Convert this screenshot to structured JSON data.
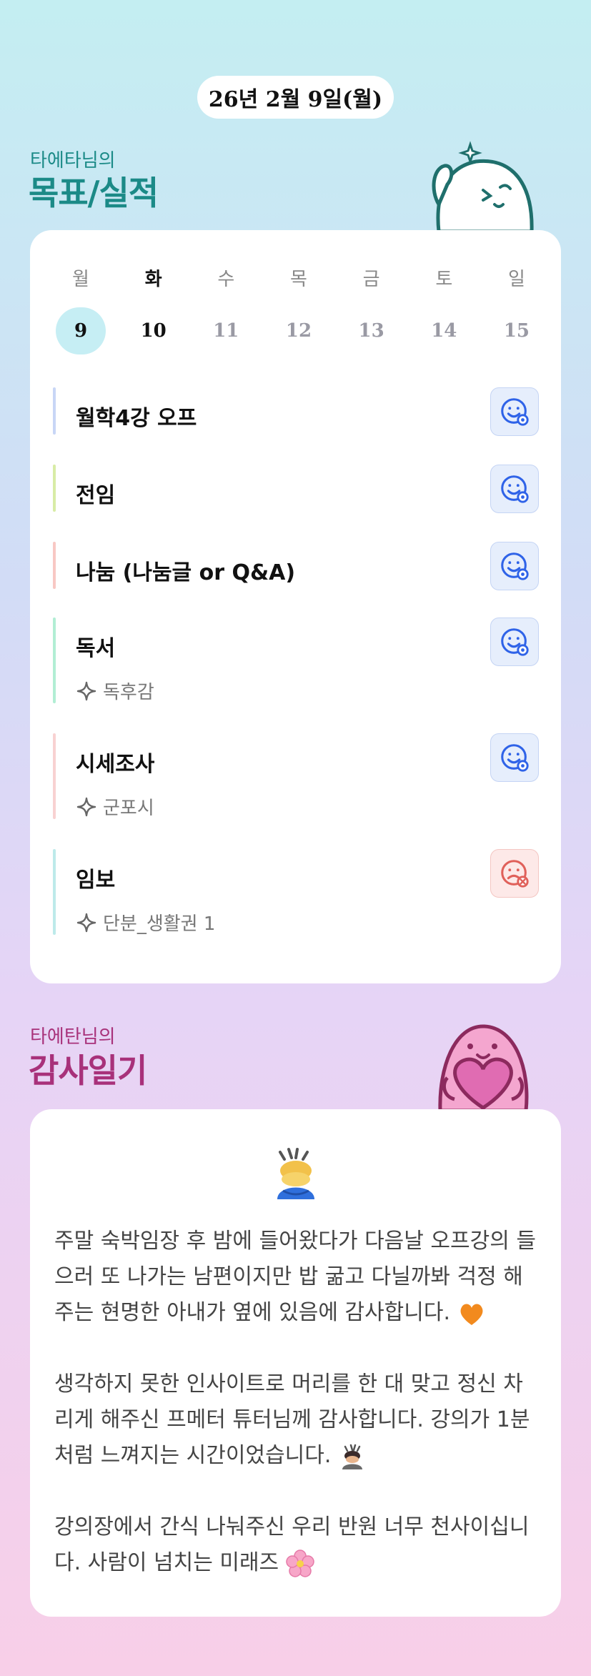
{
  "date_label": "26년 2월 9일(월)",
  "goals_section": {
    "subtitle": "타에타님의",
    "title": "목표/실적"
  },
  "calendar": {
    "weekdays": [
      "월",
      "화",
      "수",
      "목",
      "금",
      "토",
      "일"
    ],
    "dates": [
      "9",
      "10",
      "11",
      "12",
      "13",
      "14",
      "15"
    ],
    "selected_index": 0,
    "today_index": 1
  },
  "goals": [
    {
      "name": "월학4강 오프",
      "sub": "",
      "status": "done",
      "bar_color": "#c8d6f6"
    },
    {
      "name": "전임",
      "sub": "",
      "status": "done",
      "bar_color": "#d8eca6"
    },
    {
      "name": "나눔 (나눔글 or Q&A)",
      "sub": "",
      "status": "done",
      "bar_color": "#f8c8c4"
    },
    {
      "name": "독서",
      "sub": "독후감",
      "status": "done",
      "bar_color": "#b2eed4"
    },
    {
      "name": "시세조사",
      "sub": "군포시",
      "status": "done",
      "bar_color": "#f8d2d2"
    },
    {
      "name": "임보",
      "sub": "단분_생활권 1",
      "status": "failed",
      "bar_color": "#bdeaea"
    }
  ],
  "gratitude_section": {
    "subtitle": "타에탄님의",
    "title": "감사일기"
  },
  "gratitude_entries": [
    {
      "text": "주말 숙박임장 후 밤에 들어왔다가 다음날 오프강의 들으러 또 나가는 남편이지만 밥 굶고 다닐까봐 걱정 해주는 현명한 아내가 옆에 있음에 감사합니다.",
      "emoji": "orange-heart"
    },
    {
      "text": "생각하지 못한 인사이트로 머리를 한 대 맞고 정신 차리게 해주신 프메터 튜터님께 감사합니다. 강의가 1분 처럼 느껴지는 시간이었습니다.",
      "emoji": "bowing-person"
    },
    {
      "text": "강의장에서 간식 나눠주신 우리 반원 너무 천사이십니다. 사람이 넘치는 미래즈",
      "emoji": "cherry-blossom"
    }
  ],
  "colors": {
    "goal_section_title": "#1b8a87",
    "gratitude_section_title": "#a8317a",
    "badge_ok_stroke": "#2f63e8",
    "badge_fail_stroke": "#e0605a"
  },
  "icons": [
    "sparkle-icon",
    "smile-check-icon",
    "sad-x-icon",
    "bowing-person-icon",
    "orange-heart-icon",
    "cherry-blossom-icon"
  ]
}
